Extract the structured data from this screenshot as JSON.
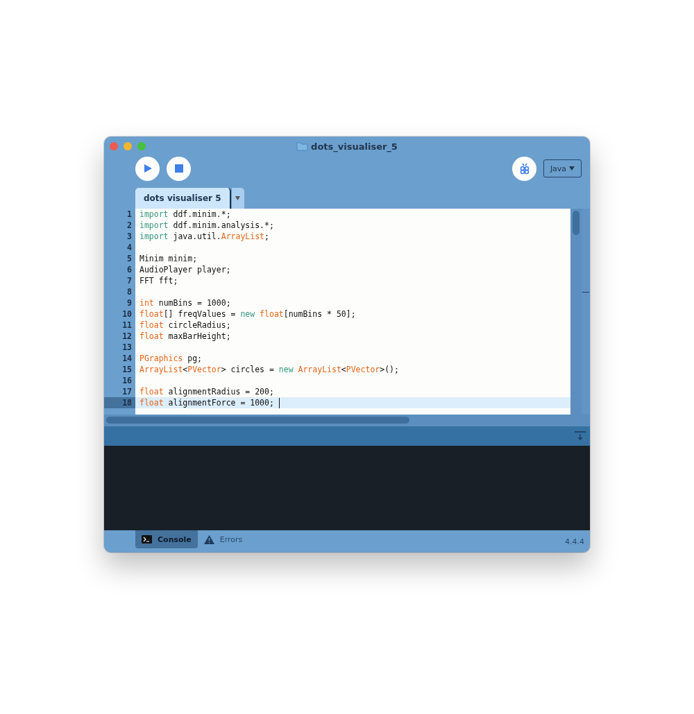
{
  "window": {
    "title": "dots_visualiser_5"
  },
  "toolbar": {
    "mode": "Java"
  },
  "tabs": [
    {
      "label": "dots visualiser 5",
      "selected": true
    }
  ],
  "editor": {
    "lines": [
      {
        "number": "1",
        "current": false,
        "tokens": [
          {
            "kind": "keyword",
            "text": "import"
          },
          {
            "kind": "plain",
            "text": " ddf.minim.*;"
          }
        ]
      },
      {
        "number": "2",
        "current": false,
        "tokens": [
          {
            "kind": "keyword",
            "text": "import"
          },
          {
            "kind": "plain",
            "text": " ddf.minim.analysis.*;"
          }
        ]
      },
      {
        "number": "3",
        "current": false,
        "tokens": [
          {
            "kind": "keyword",
            "text": "import"
          },
          {
            "kind": "plain",
            "text": " java.util."
          },
          {
            "kind": "type",
            "text": "ArrayList"
          },
          {
            "kind": "plain",
            "text": ";"
          }
        ]
      },
      {
        "number": "4",
        "current": false
      },
      {
        "number": "5",
        "current": false,
        "tokens": [
          {
            "kind": "plain",
            "text": "Minim minim;"
          }
        ]
      },
      {
        "number": "6",
        "current": false,
        "tokens": [
          {
            "kind": "plain",
            "text": "AudioPlayer player;"
          }
        ]
      },
      {
        "number": "7",
        "current": false,
        "tokens": [
          {
            "kind": "plain",
            "text": "FFT fft;"
          }
        ]
      },
      {
        "number": "8",
        "current": false
      },
      {
        "number": "9",
        "current": false,
        "tokens": [
          {
            "kind": "type",
            "text": "int"
          },
          {
            "kind": "plain",
            "text": " numBins = 1000;"
          }
        ]
      },
      {
        "number": "10",
        "current": false,
        "tokens": [
          {
            "kind": "type",
            "text": "float"
          },
          {
            "kind": "plain",
            "text": "[] freqValues = "
          },
          {
            "kind": "keyword",
            "text": "new "
          },
          {
            "kind": "type",
            "text": "float"
          },
          {
            "kind": "plain",
            "text": "[numBins * 50];"
          }
        ]
      },
      {
        "number": "11",
        "current": false,
        "tokens": [
          {
            "kind": "type",
            "text": "float"
          },
          {
            "kind": "plain",
            "text": " circleRadius;"
          }
        ]
      },
      {
        "number": "12",
        "current": false,
        "tokens": [
          {
            "kind": "type",
            "text": "float"
          },
          {
            "kind": "plain",
            "text": " maxBarHeight;"
          }
        ]
      },
      {
        "number": "13",
        "current": false
      },
      {
        "number": "14",
        "current": false,
        "tokens": [
          {
            "kind": "type",
            "text": "PGraphics"
          },
          {
            "kind": "plain",
            "text": " pg;"
          }
        ]
      },
      {
        "number": "15",
        "current": false,
        "tokens": [
          {
            "kind": "type",
            "text": "ArrayList"
          },
          {
            "kind": "plain",
            "text": "<"
          },
          {
            "kind": "type",
            "text": "PVector"
          },
          {
            "kind": "plain",
            "text": "> circles = "
          },
          {
            "kind": "keyword",
            "text": "new "
          },
          {
            "kind": "type",
            "text": "ArrayList"
          },
          {
            "kind": "plain",
            "text": "<"
          },
          {
            "kind": "type",
            "text": "PVector"
          },
          {
            "kind": "plain",
            "text": ">();"
          }
        ]
      },
      {
        "number": "16",
        "current": false
      },
      {
        "number": "17",
        "current": false,
        "tokens": [
          {
            "kind": "type",
            "text": "float"
          },
          {
            "kind": "plain",
            "text": " alignmentRadius = 200;"
          }
        ]
      },
      {
        "number": "18",
        "current": true,
        "tokens": [
          {
            "kind": "type",
            "text": "float"
          },
          {
            "kind": "plain",
            "text": " alignmentForce = 1000;"
          }
        ]
      }
    ]
  },
  "console_tabs": [
    {
      "label": "Console",
      "selected": true,
      "kind": "console"
    },
    {
      "label": "Errors",
      "selected": false,
      "kind": "errors"
    }
  ],
  "version": "4.4.4"
}
